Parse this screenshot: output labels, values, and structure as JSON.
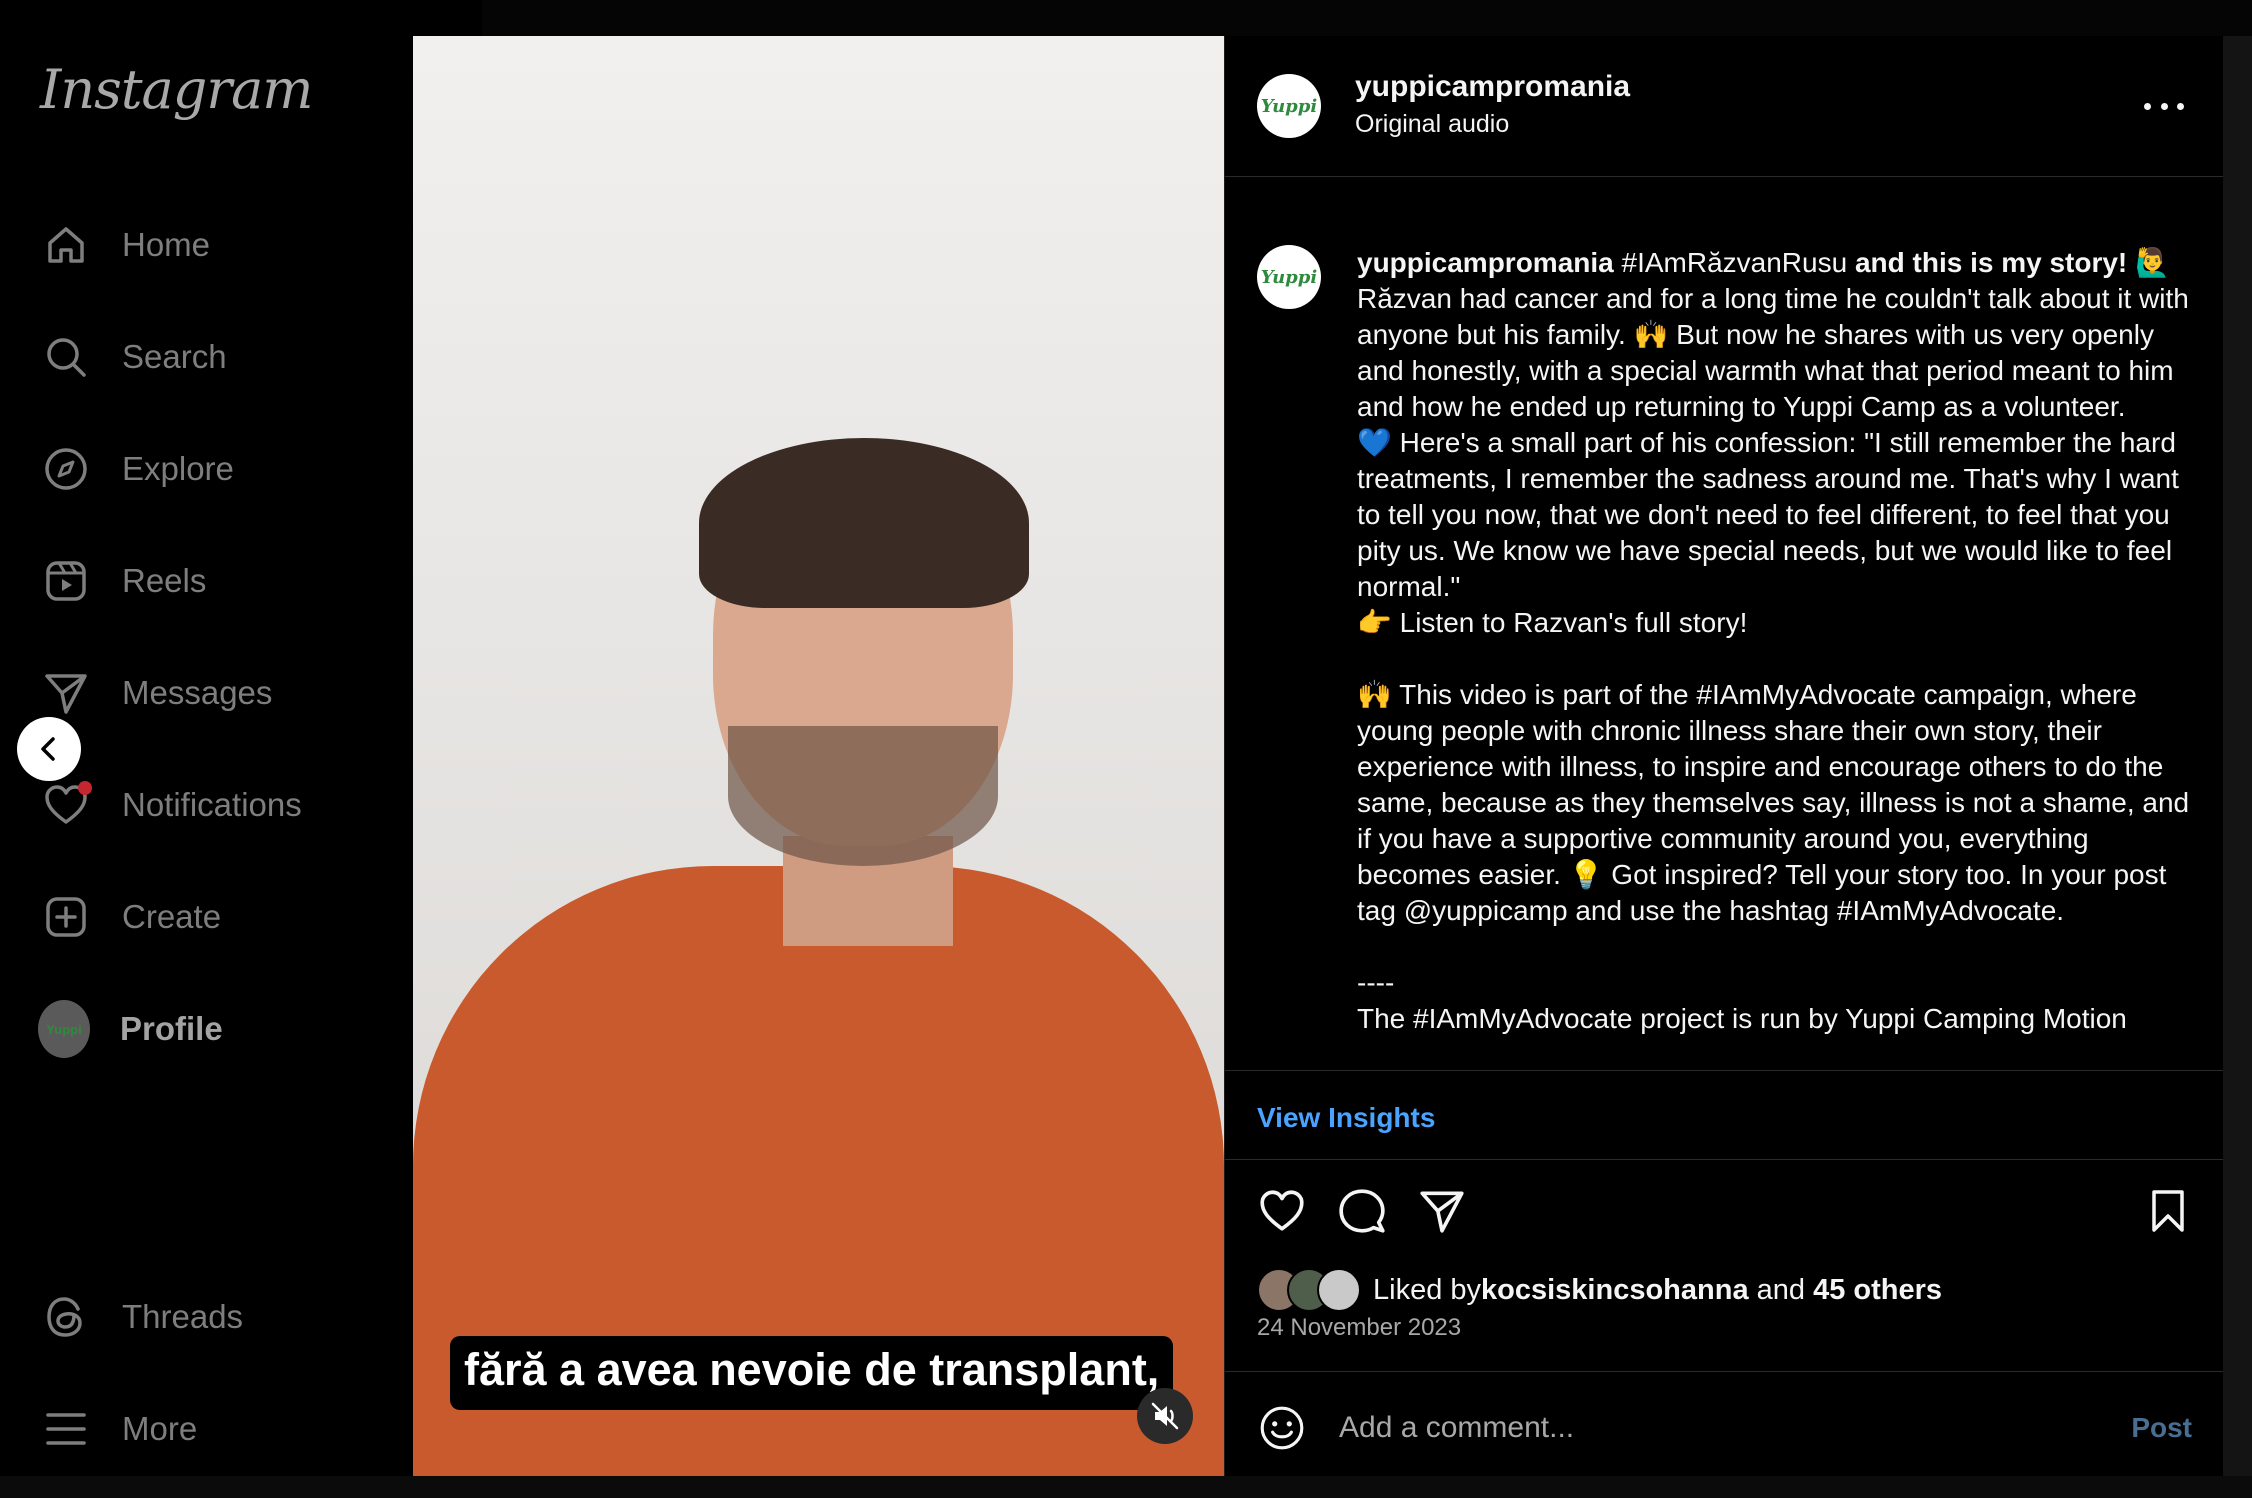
{
  "sidebar": {
    "logo": "Instagram",
    "items": [
      {
        "label": "Home",
        "icon": "home-icon"
      },
      {
        "label": "Search",
        "icon": "search-icon"
      },
      {
        "label": "Explore",
        "icon": "compass-icon"
      },
      {
        "label": "Reels",
        "icon": "reels-icon"
      },
      {
        "label": "Messages",
        "icon": "send-icon"
      },
      {
        "label": "Notifications",
        "icon": "heart-icon"
      },
      {
        "label": "Create",
        "icon": "plus-square-icon"
      },
      {
        "label": "Profile",
        "icon": "avatar"
      }
    ],
    "bottom_items": [
      {
        "label": "Threads",
        "icon": "threads-icon"
      },
      {
        "label": "More",
        "icon": "menu-icon"
      }
    ]
  },
  "video": {
    "caption": "fără a avea nevoie de transplant,"
  },
  "post": {
    "username": "yuppicampromania",
    "audio": "Original audio",
    "avatar_text": "Yuppi",
    "caption": {
      "username": "yuppicampromania",
      "hashtag": "#IAmRăzvanRusu",
      "headline": " and this is my story! 🙋‍♂️",
      "body": "Răzvan had cancer and for a long time he couldn't talk about it with anyone but his family. 🙌 But now he shares with us very openly and honestly, with a special warmth what that period meant to him and how he ended up returning to Yuppi Camp as a volunteer.\n💙 Here's a small part of his confession: \"I still remember the hard treatments, I remember the sadness around me. That's why I want to tell you now, that we don't need to feel different, to feel that you pity us. We know we have special needs, but we would like to feel normal.\"\n👉 Listen to Razvan's full story!\n\n🙌 This video is part of the #IAmMyAdvocate campaign, where young people with chronic illness share their own story, their experience with illness, to inspire and encourage others to do the same, because as they themselves say, illness is not a shame, and if you have a supportive community around you, everything becomes easier. 💡 Got inspired? Tell your story too. In your post tag @yuppicamp and use the hashtag #IAmMyAdvocate.\n\n----\nThe #IAmMyAdvocate project is run by Yuppi Camping Motion"
    },
    "insights_label": "View Insights",
    "likes": {
      "prefix": "Liked by ",
      "user": "kocsiskincsohanna",
      "middle": " and ",
      "others": "45 others"
    },
    "date": "24 November 2023",
    "comment_placeholder": "Add a comment...",
    "post_label": "Post"
  },
  "colors": {
    "accent_link": "#4aa3ff",
    "post_button": "#4a6e92",
    "sweater": "#c85a2d",
    "notification_dot": "#c4272f"
  }
}
